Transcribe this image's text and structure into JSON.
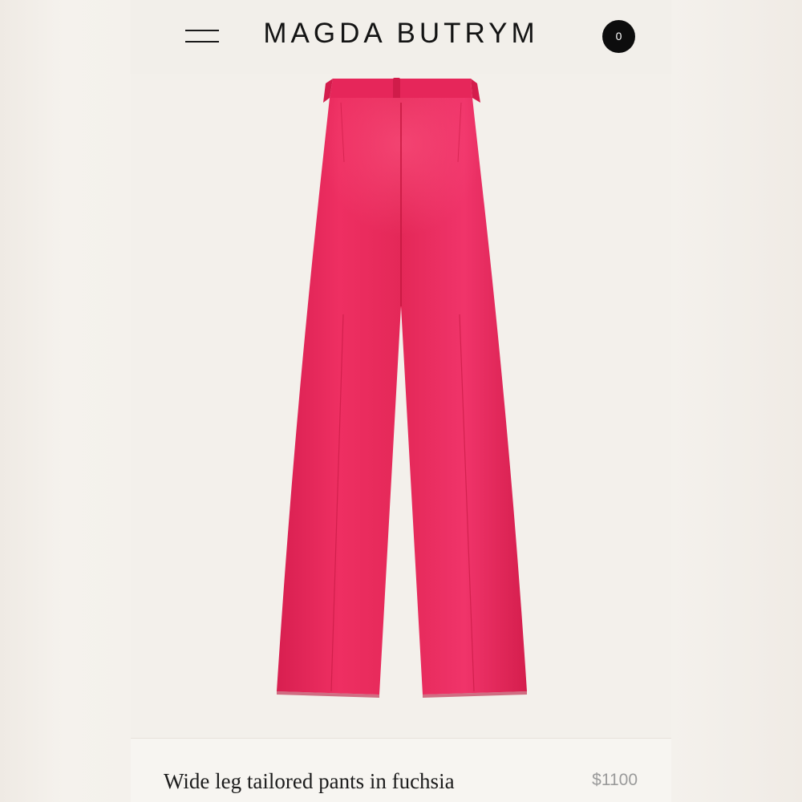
{
  "header": {
    "brand": "MAGDA BUTRYM",
    "cart_count": "0",
    "menu_icon": "hamburger-menu-icon"
  },
  "product": {
    "name": "Wide leg tailored pants in fuchsia",
    "price": "$1100",
    "color": "#ec2a5e"
  },
  "colors": {
    "background": "#f2efea",
    "text": "#1c1c1c",
    "price_text": "#9a9a9a",
    "badge": "#0d0d0d",
    "product": "#ec2a5e"
  }
}
